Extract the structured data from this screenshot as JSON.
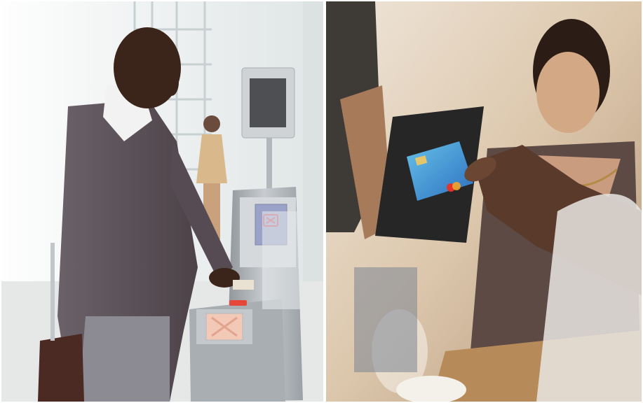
{
  "scene": {
    "left": {
      "gate_screen_icon": "cross-icon",
      "colors": {
        "sky": "#f2f4f4",
        "suit": "#5a4e55",
        "gate_metal": "#b8bcc0",
        "screen": "#9aa2c8",
        "red_light": "#e5483b"
      }
    },
    "right": {
      "card_brand_icon": "mastercard-logo-icon",
      "colors": {
        "background": "#dccbb4",
        "phone": "#2a2a2a",
        "card": "#3a8fd6",
        "blouse": "#5d4a45",
        "skin": "#c79a7c"
      }
    }
  }
}
